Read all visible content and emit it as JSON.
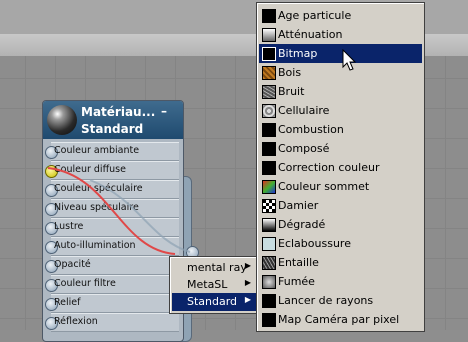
{
  "node": {
    "title": "Matériau...",
    "subtitle": "Standard",
    "collapse": "–",
    "slots": [
      {
        "label": "Couleur ambiante",
        "connected": false
      },
      {
        "label": "Couleur diffuse",
        "connected": true
      },
      {
        "label": "Couleur spéculaire",
        "connected": false
      },
      {
        "label": "Niveau spéculaire",
        "connected": false
      },
      {
        "label": "Lustre",
        "connected": false
      },
      {
        "label": "Auto-illumination",
        "connected": false
      },
      {
        "label": "Opacité",
        "connected": false
      },
      {
        "label": "Couleur filtre",
        "connected": false
      },
      {
        "label": "Relief",
        "connected": false
      },
      {
        "label": "Réflexion",
        "connected": false
      }
    ]
  },
  "context_menu": {
    "items": [
      {
        "label": "mental ray",
        "submenu": true,
        "selected": false
      },
      {
        "label": "MetaSL",
        "submenu": true,
        "selected": false
      },
      {
        "label": "Standard",
        "submenu": true,
        "selected": true
      }
    ]
  },
  "map_menu": {
    "items": [
      {
        "label": "Age particule",
        "swatch": "#000000",
        "selected": false
      },
      {
        "label": "Atténuation",
        "swatch": "#b8b8b8",
        "selected": false
      },
      {
        "label": "Bitmap",
        "swatch": "#000000",
        "selected": true
      },
      {
        "label": "Bois",
        "swatch": "#b07020",
        "selected": false
      },
      {
        "label": "Bruit",
        "swatch": "#8a8a8a",
        "selected": false
      },
      {
        "label": "Cellulaire",
        "swatch": "#a8a8a8",
        "selected": false
      },
      {
        "label": "Combustion",
        "swatch": "#000000",
        "selected": false
      },
      {
        "label": "Composé",
        "swatch": "#000000",
        "selected": false
      },
      {
        "label": "Correction couleur",
        "swatch": "#000000",
        "selected": false
      },
      {
        "label": "Couleur sommet",
        "swatch": "#3aa030",
        "selected": false
      },
      {
        "label": "Damier",
        "swatch": "#000000",
        "selected": false
      },
      {
        "label": "Dégradé",
        "swatch": "#707070",
        "selected": false
      },
      {
        "label": "Eclaboussure",
        "swatch": "#c8dde0",
        "selected": false
      },
      {
        "label": "Entaille",
        "swatch": "#6a6a6a",
        "selected": false
      },
      {
        "label": "Fumée",
        "swatch": "#a0a0a0",
        "selected": false
      },
      {
        "label": "Lancer de rayons",
        "swatch": "#000000",
        "selected": false
      },
      {
        "label": "Map Caméra par pixel",
        "swatch": "#000000",
        "selected": false
      }
    ]
  },
  "colors": {
    "selection": "#0a246a",
    "node_header": "#2a5378",
    "wire": "#e04848"
  }
}
